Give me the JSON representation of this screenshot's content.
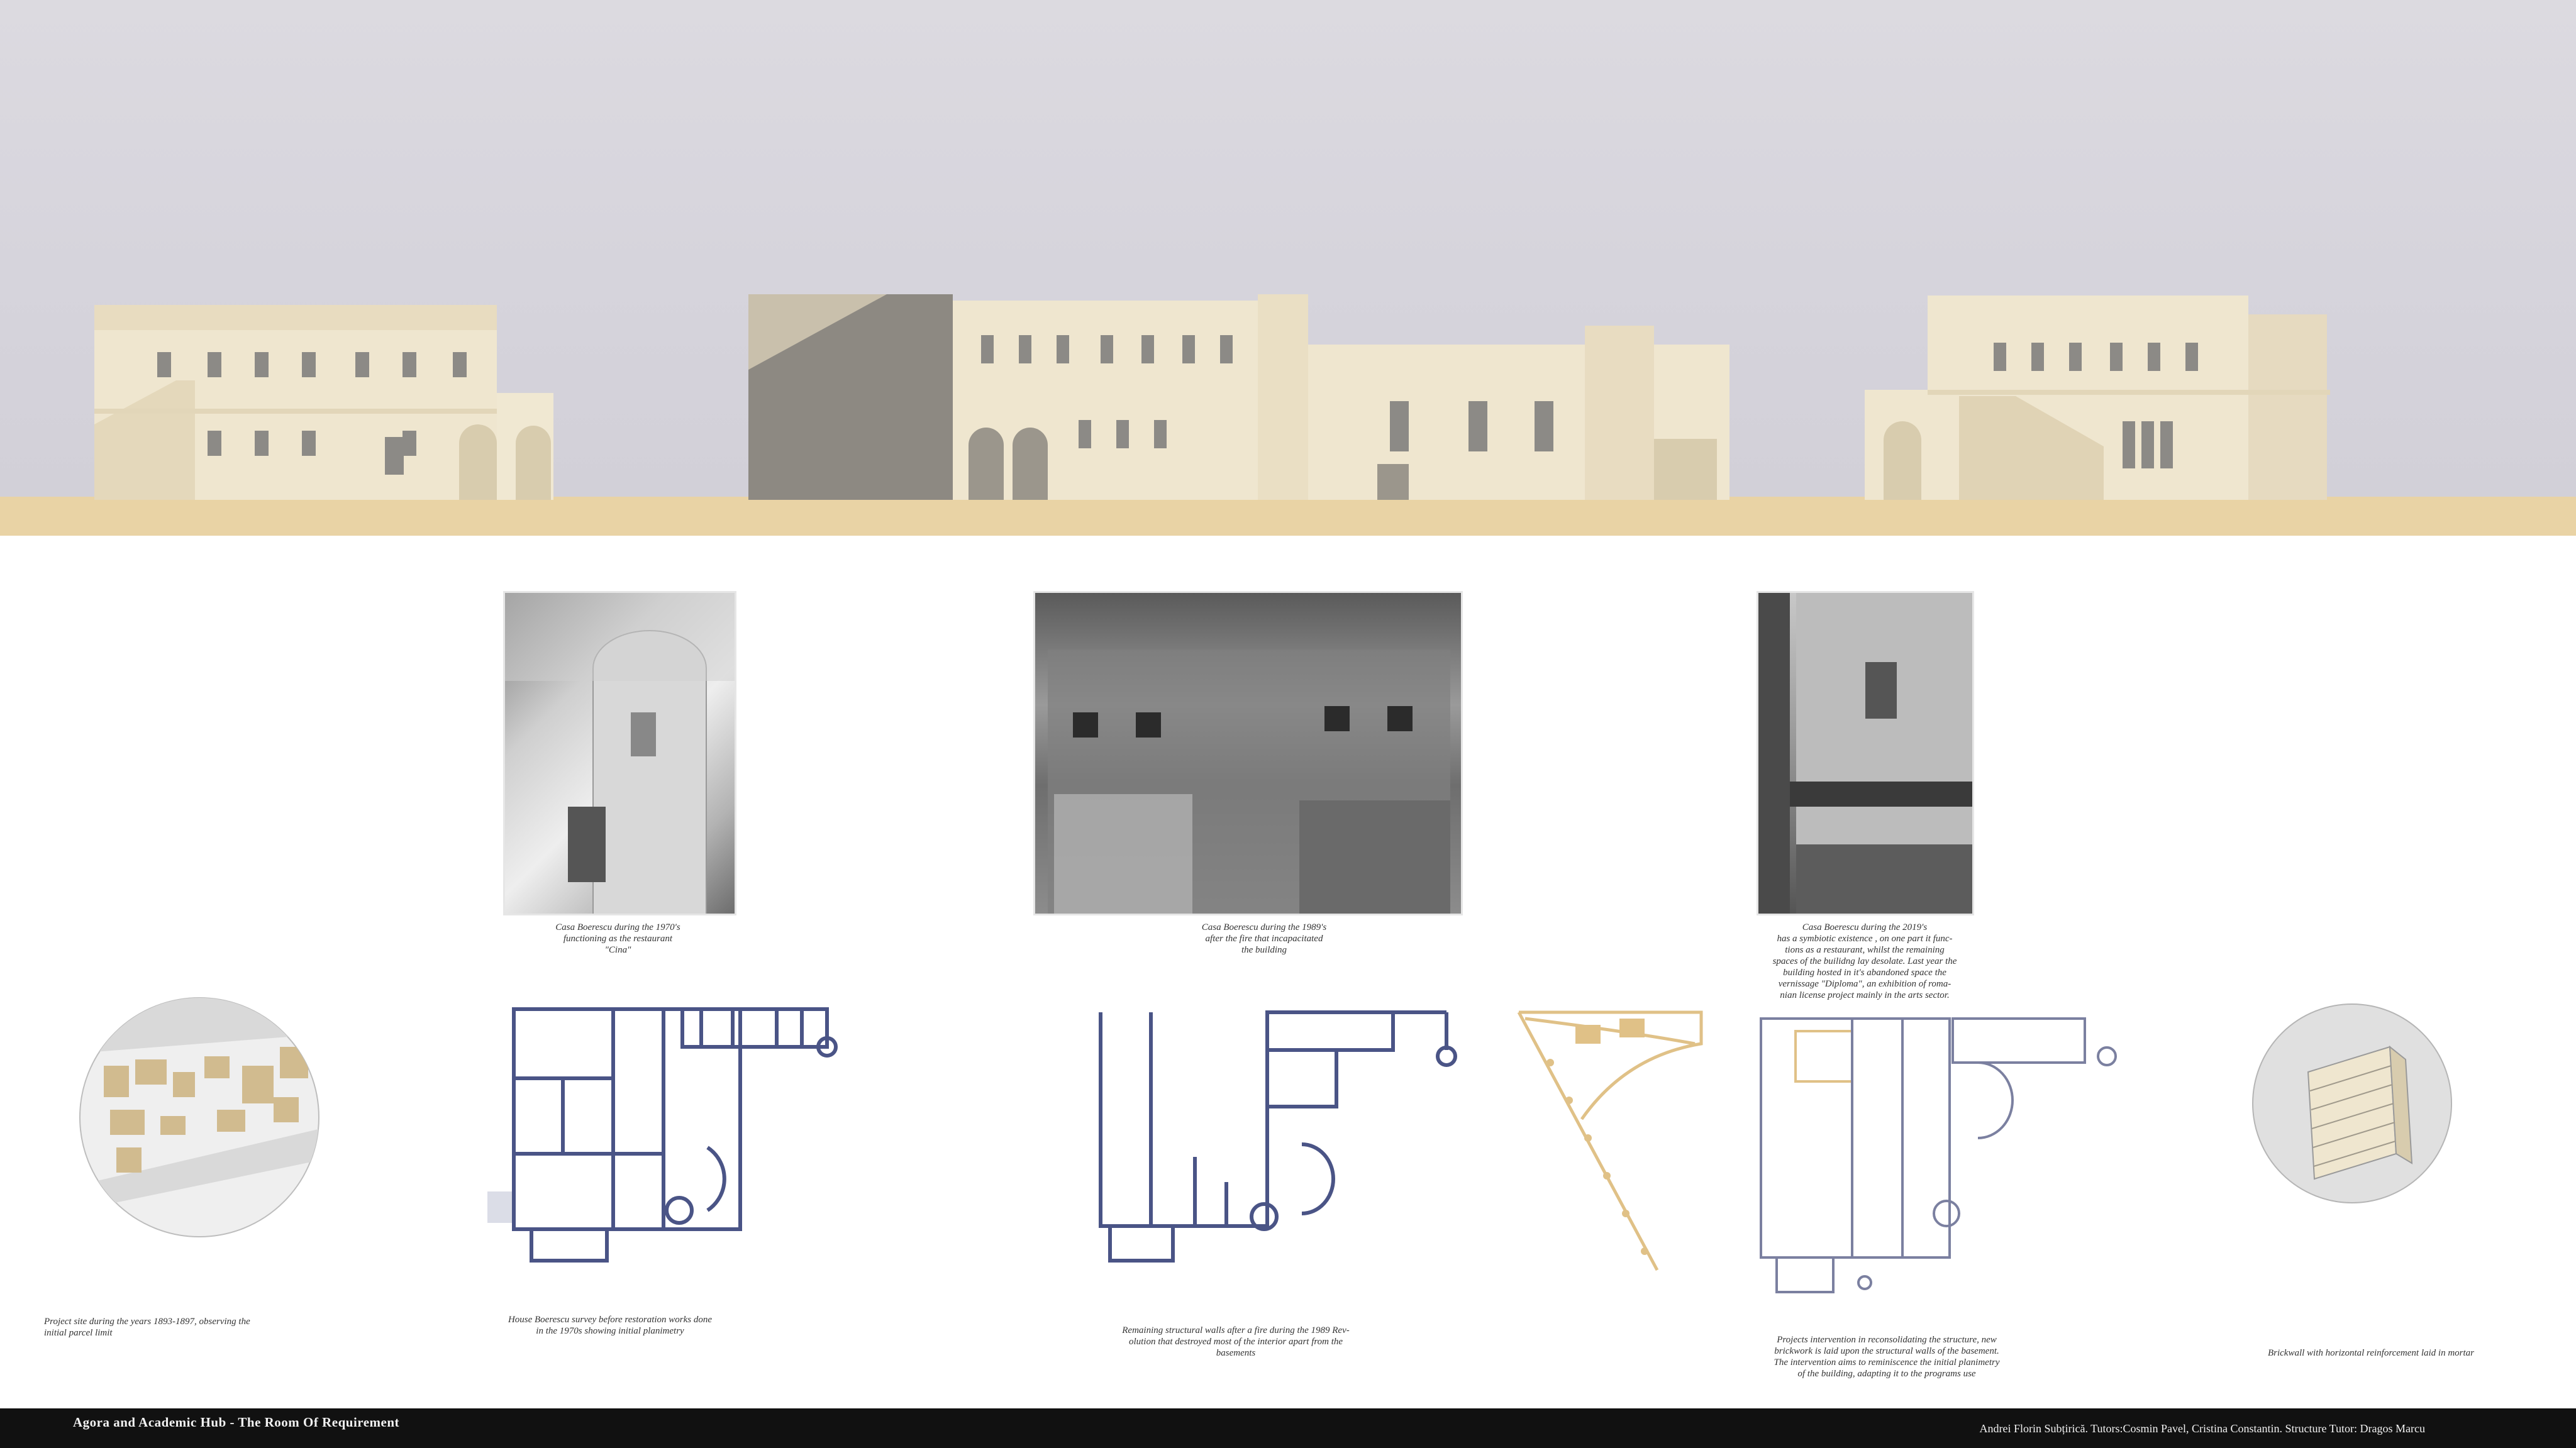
{
  "photos": [
    {
      "caption": "Casa Boerescu during the 1970's\nfunctioning as the restaurant\n\"Cina\""
    },
    {
      "caption": "Casa Boerescu during the 1989's\nafter the fire that incapacitated\nthe building"
    },
    {
      "caption": "Casa Boerescu during the 2019's\nhas a symbiotic existence , on one part it func-\ntions as a restaurant, whilst the remaining\nspaces of the builidng lay desolate. Last year the\nbuilding hosted in it's abandoned space the\nvernissage \"Diploma\", an exhibition of roma-\nnian license project mainly in the arts sector."
    }
  ],
  "plans": [
    {
      "caption": "Project site during the years 1893-1897, observing the\ninitial parcel limit"
    },
    {
      "caption": "House Boerescu survey before restoration works done\nin the 1970s showing initial planimetry"
    },
    {
      "caption": "Remaining structural walls after a fire during the 1989 Rev-\nolution that destroyed most of the interior apart from the\nbasements"
    },
    {
      "caption": "Projects intervention in reconsolidating the structure, new\nbrickwork is laid upon the structural walls of the basement.\nThe intervention aims to reminiscence the initial planimetry\nof the building, adapting it to the programs use"
    },
    {
      "caption": "Brickwall with horizontal reinforcement laid in mortar"
    }
  ],
  "footer": {
    "title": "Agora  and Academic Hub - The Room Of Requirement",
    "credits": "Andrei Florin Subțirică. Tutors:Cosmin Pavel, Cristina Constantin. Structure Tutor: Dragos Marcu"
  },
  "colors": {
    "plan_blue": "#4a5486",
    "sand": "#e9d3a5",
    "facade": "#efe6cf",
    "accent_gold": "#e0c187"
  }
}
